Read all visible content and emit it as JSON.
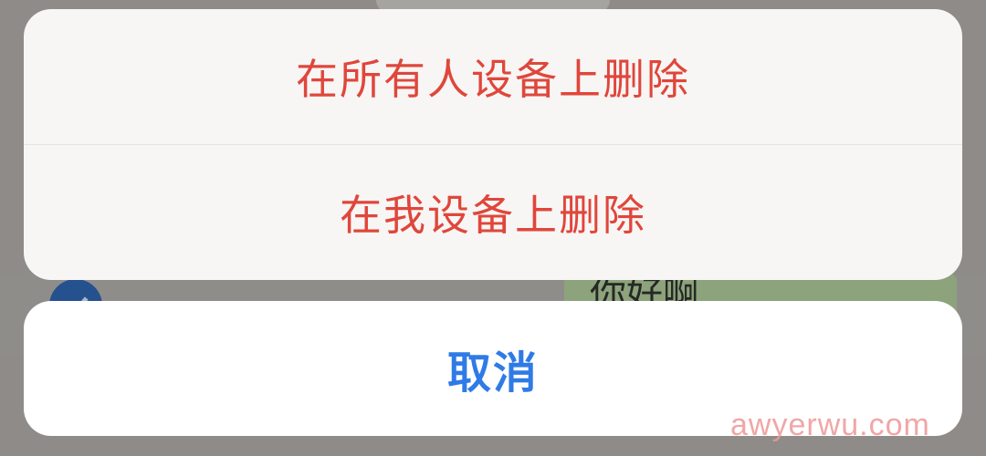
{
  "background": {
    "bubble_text": "你好啊"
  },
  "action_sheet": {
    "actions": [
      {
        "label": "在所有人设备上删除",
        "color": "#e0463b",
        "role": "destructive"
      },
      {
        "label": "在我设备上删除",
        "color": "#e0463b",
        "role": "destructive"
      }
    ],
    "cancel": {
      "label": "取消",
      "color": "#2f7be6"
    }
  },
  "watermark": "awyerwu.com",
  "colors": {
    "destructive": "#e0463b",
    "accent": "#2f7be6",
    "sheet_background": "#f7f6f4",
    "dim_overlay": "#8e8b88"
  }
}
